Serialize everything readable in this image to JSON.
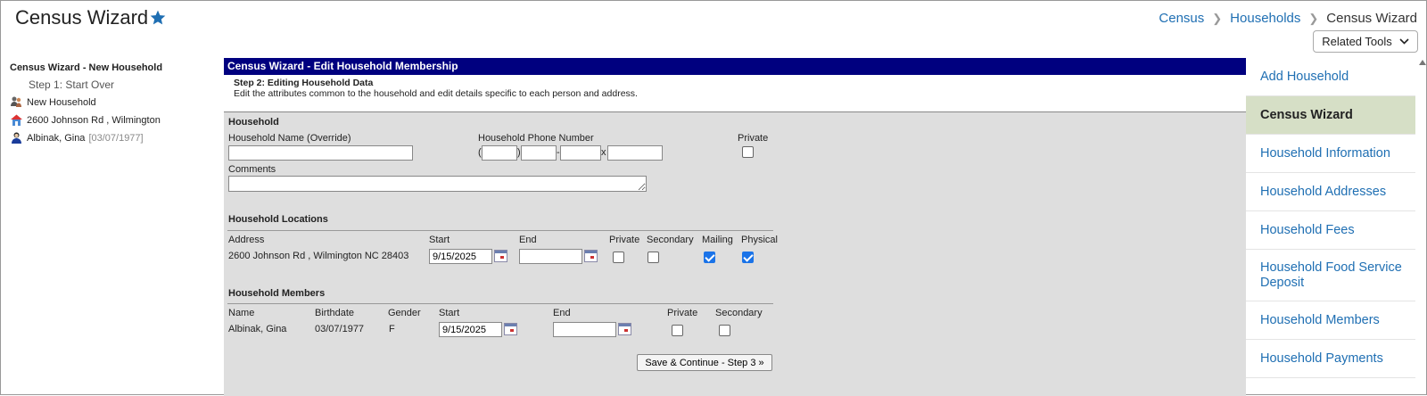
{
  "header": {
    "title": "Census Wizard",
    "breadcrumb": {
      "census": "Census",
      "households": "Households",
      "current": "Census Wizard"
    },
    "related_tools": "Related Tools"
  },
  "nav": {
    "title": "Census Wizard",
    "title_sep": " - ",
    "subtitle": "New Household",
    "step1": "Step 1: Start Over",
    "tree": {
      "household": "New Household",
      "address": "2600 Johnson Rd , Wilmington",
      "person_name": "Albinak, Gina",
      "person_dob": "[03/07/1977]"
    }
  },
  "main": {
    "header": "Census Wizard - Edit Household Membership",
    "step_title": "Step 2: Editing Household Data",
    "step_desc": "Edit the attributes common to the household and edit details specific to each person and address.",
    "household": {
      "section": "Household",
      "name_label": "Household Name (Override)",
      "phone_label": "Household Phone Number",
      "private_label": "Private",
      "comments_label": "Comments",
      "phone_open": "(",
      "phone_close": ")",
      "phone_dash": "-",
      "phone_ext": "x"
    },
    "locations": {
      "section": "Household Locations",
      "cols": {
        "address": "Address",
        "start": "Start",
        "end": "End",
        "private": "Private",
        "secondary": "Secondary",
        "mailing": "Mailing",
        "physical": "Physical"
      },
      "row": {
        "address": "2600 Johnson Rd , Wilmington NC 28403",
        "start": "9/15/2025",
        "end": ""
      }
    },
    "members": {
      "section": "Household Members",
      "cols": {
        "name": "Name",
        "birthdate": "Birthdate",
        "gender": "Gender",
        "start": "Start",
        "end": "End",
        "private": "Private",
        "secondary": "Secondary"
      },
      "row": {
        "name": "Albinak, Gina",
        "birthdate": "03/07/1977",
        "gender": "F",
        "start": "9/15/2025",
        "end": ""
      }
    },
    "save_button": "Save & Continue - Step 3 »"
  },
  "right_panel": {
    "items": [
      "Add Household",
      "Census Wizard",
      "Household Information",
      "Household Addresses",
      "Household Fees",
      "Household Food Service Deposit",
      "Household Members",
      "Household Payments"
    ]
  },
  "colors": {
    "link": "#1f6fb3",
    "header_bar": "#00007f",
    "active_item": "#d6dfc6",
    "panel_bg": "#dedede"
  }
}
